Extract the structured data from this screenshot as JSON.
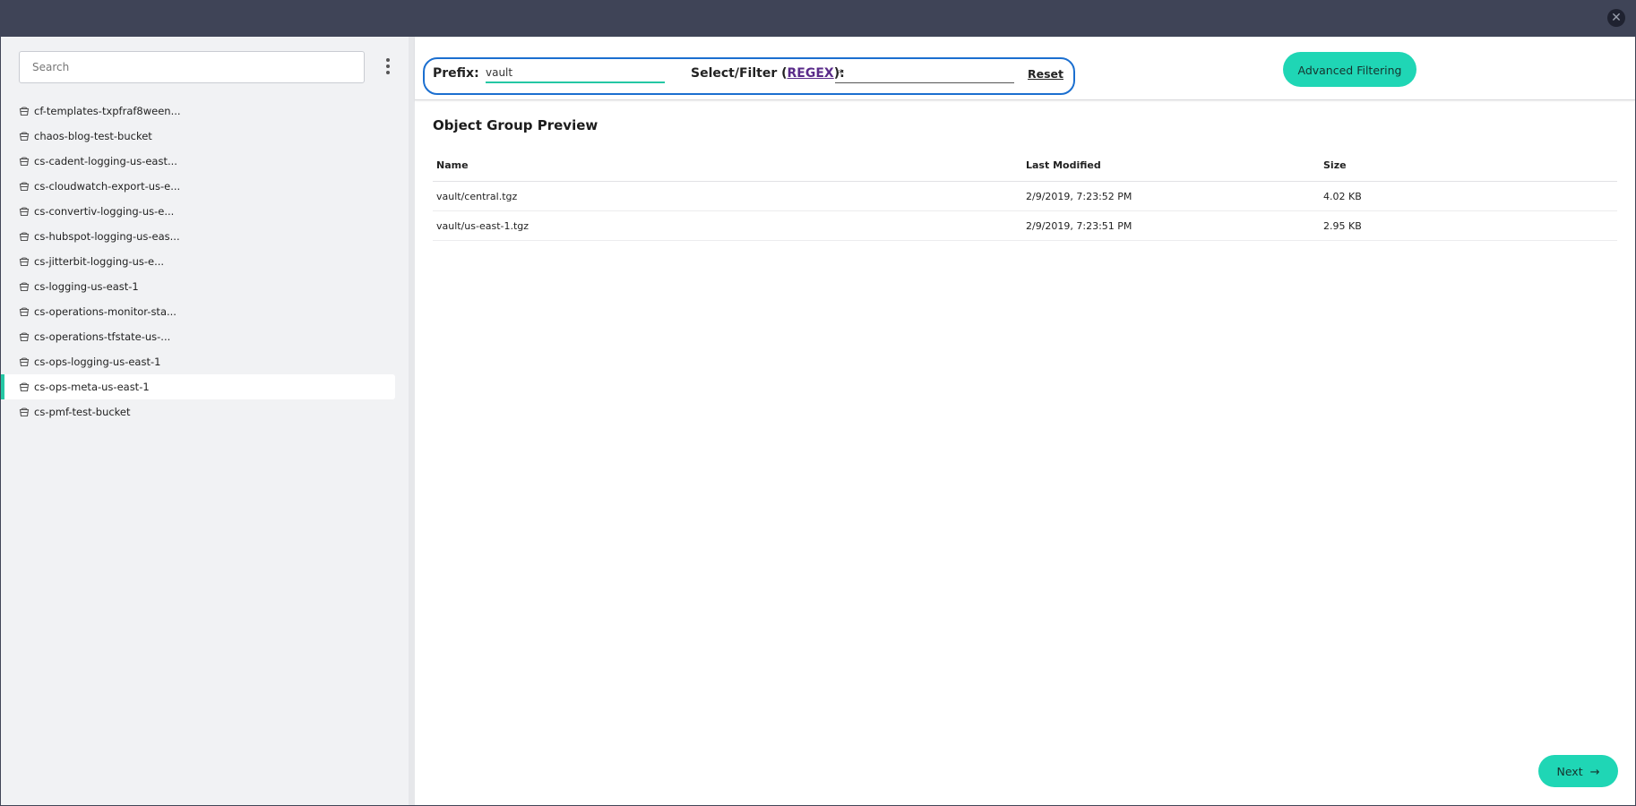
{
  "window": {
    "close_icon": "close-icon"
  },
  "sidebar": {
    "search_placeholder": "Search",
    "buckets": [
      {
        "label": "cf-templates-txpfraf8ween..."
      },
      {
        "label": "chaos-blog-test-bucket"
      },
      {
        "label": "cs-cadent-logging-us-east..."
      },
      {
        "label": "cs-cloudwatch-export-us-e..."
      },
      {
        "label": "cs-convertiv-logging-us-e..."
      },
      {
        "label": "cs-hubspot-logging-us-eas..."
      },
      {
        "label": "cs-jitterbit-logging-us-e..."
      },
      {
        "label": "cs-logging-us-east-1"
      },
      {
        "label": "cs-operations-monitor-sta..."
      },
      {
        "label": "cs-operations-tfstate-us-..."
      },
      {
        "label": "cs-ops-logging-us-east-1"
      },
      {
        "label": "cs-ops-meta-us-east-1"
      },
      {
        "label": "cs-pmf-test-bucket"
      }
    ],
    "selected_index": 11
  },
  "filter": {
    "prefix_label": "Prefix:",
    "prefix_value": "vault",
    "select_label_pre": "Select/Filter (",
    "regex_link": "REGEX",
    "select_label_post": "):",
    "filter_value": ".*",
    "reset_label": "Reset",
    "advanced_button": "Advanced Filtering"
  },
  "preview": {
    "title": "Object Group Preview",
    "columns": {
      "name": "Name",
      "modified": "Last Modified",
      "size": "Size"
    },
    "rows": [
      {
        "name": "vault/central.tgz",
        "modified": "2/9/2019, 7:23:52 PM",
        "size": "4.02 KB"
      },
      {
        "name": "vault/us-east-1.tgz",
        "modified": "2/9/2019, 7:23:51 PM",
        "size": "2.95 KB"
      }
    ]
  },
  "footer": {
    "next_label": "Next"
  },
  "colors": {
    "accent": "#1fd6b5",
    "highlight_border": "#1b6fd0",
    "selected_bar": "#25c7a4"
  }
}
